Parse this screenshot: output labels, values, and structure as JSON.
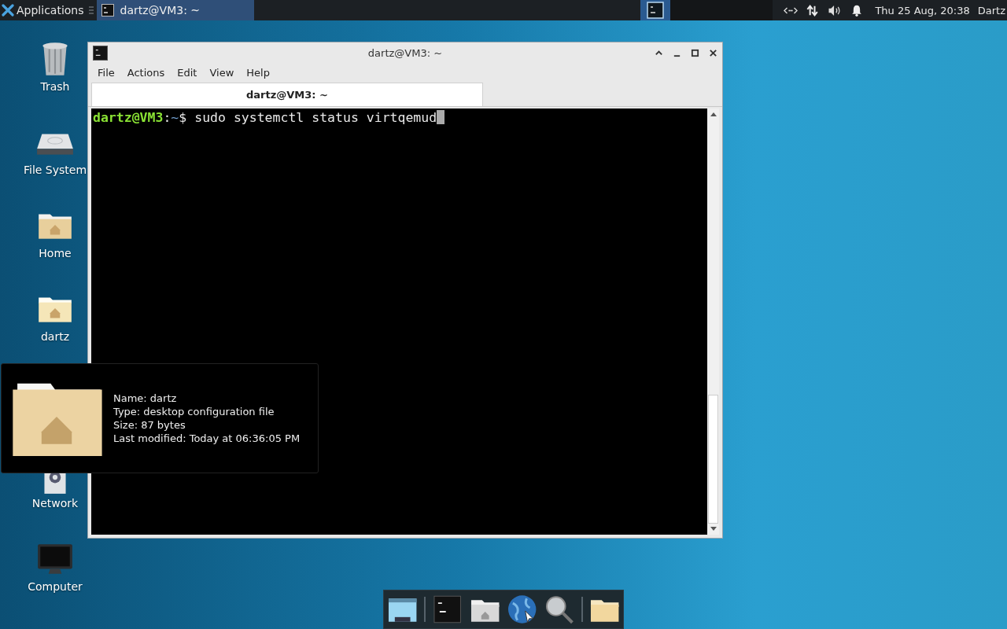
{
  "top_panel": {
    "menu_label": "Applications",
    "tasks": [
      {
        "label": "dartz@VM3: ~",
        "selected": true
      }
    ],
    "clock": "Thu 25 Aug, 20:38",
    "user": "Dartz"
  },
  "desktop_icons": [
    {
      "label": "Trash",
      "kind": "trash"
    },
    {
      "label": "File System",
      "kind": "drive"
    },
    {
      "label": "Home",
      "kind": "home-folder"
    },
    {
      "label": "dartz",
      "kind": "home-folder-light"
    },
    {
      "label": "Network",
      "kind": "network"
    },
    {
      "label": "Computer",
      "kind": "computer"
    }
  ],
  "window": {
    "title": "dartz@VM3: ~",
    "menu": [
      "File",
      "Actions",
      "Edit",
      "View",
      "Help"
    ],
    "tabs": [
      {
        "label": "dartz@VM3: ~",
        "selected": true
      }
    ],
    "terminal": {
      "user": "dartz@VM3",
      "separator": ":",
      "path": "~",
      "symbol": "$",
      "command": "sudo systemctl status virtqemud"
    }
  },
  "tooltip": {
    "lines": [
      "Name: dartz",
      "Type: desktop configuration file",
      "Size: 87 bytes",
      "Last modified: Today at 06:36:05 PM"
    ]
  }
}
